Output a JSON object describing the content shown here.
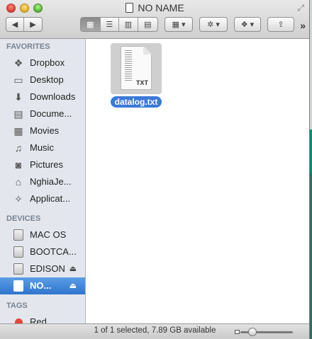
{
  "window": {
    "title": "NO NAME"
  },
  "toolbar": {
    "back_icon": "chevron-left-icon",
    "forward_icon": "chevron-right-icon",
    "view_modes": [
      "icon-view",
      "list-view",
      "column-view",
      "cover-flow-view"
    ],
    "active_view": "icon-view",
    "more_label": "»"
  },
  "sidebar": {
    "favorites_header": "FAVORITES",
    "favorites": [
      {
        "label": "Dropbox",
        "icon": "dropbox-icon"
      },
      {
        "label": "Desktop",
        "icon": "desktop-icon"
      },
      {
        "label": "Downloads",
        "icon": "downloads-icon"
      },
      {
        "label": "Docume...",
        "icon": "documents-icon"
      },
      {
        "label": "Movies",
        "icon": "movies-icon"
      },
      {
        "label": "Music",
        "icon": "music-icon"
      },
      {
        "label": "Pictures",
        "icon": "pictures-icon"
      },
      {
        "label": "NghiaJe...",
        "icon": "home-icon"
      },
      {
        "label": "Applicat...",
        "icon": "applications-icon"
      }
    ],
    "devices_header": "DEVICES",
    "devices": [
      {
        "label": "MAC OS",
        "eject": false
      },
      {
        "label": "BOOTCA...",
        "eject": false
      },
      {
        "label": "EDISON",
        "eject": true
      },
      {
        "label": "NO...",
        "eject": true,
        "selected": true
      }
    ],
    "tags_header": "TAGS",
    "tags": [
      {
        "label": "Red",
        "color": "#e5453c"
      }
    ]
  },
  "content": {
    "files": [
      {
        "name": "datalog.txt",
        "ext": "TXT",
        "selected": true
      }
    ]
  },
  "status": {
    "text": "1 of 1 selected, 7.89 GB available",
    "zoom_level": 0.18
  }
}
